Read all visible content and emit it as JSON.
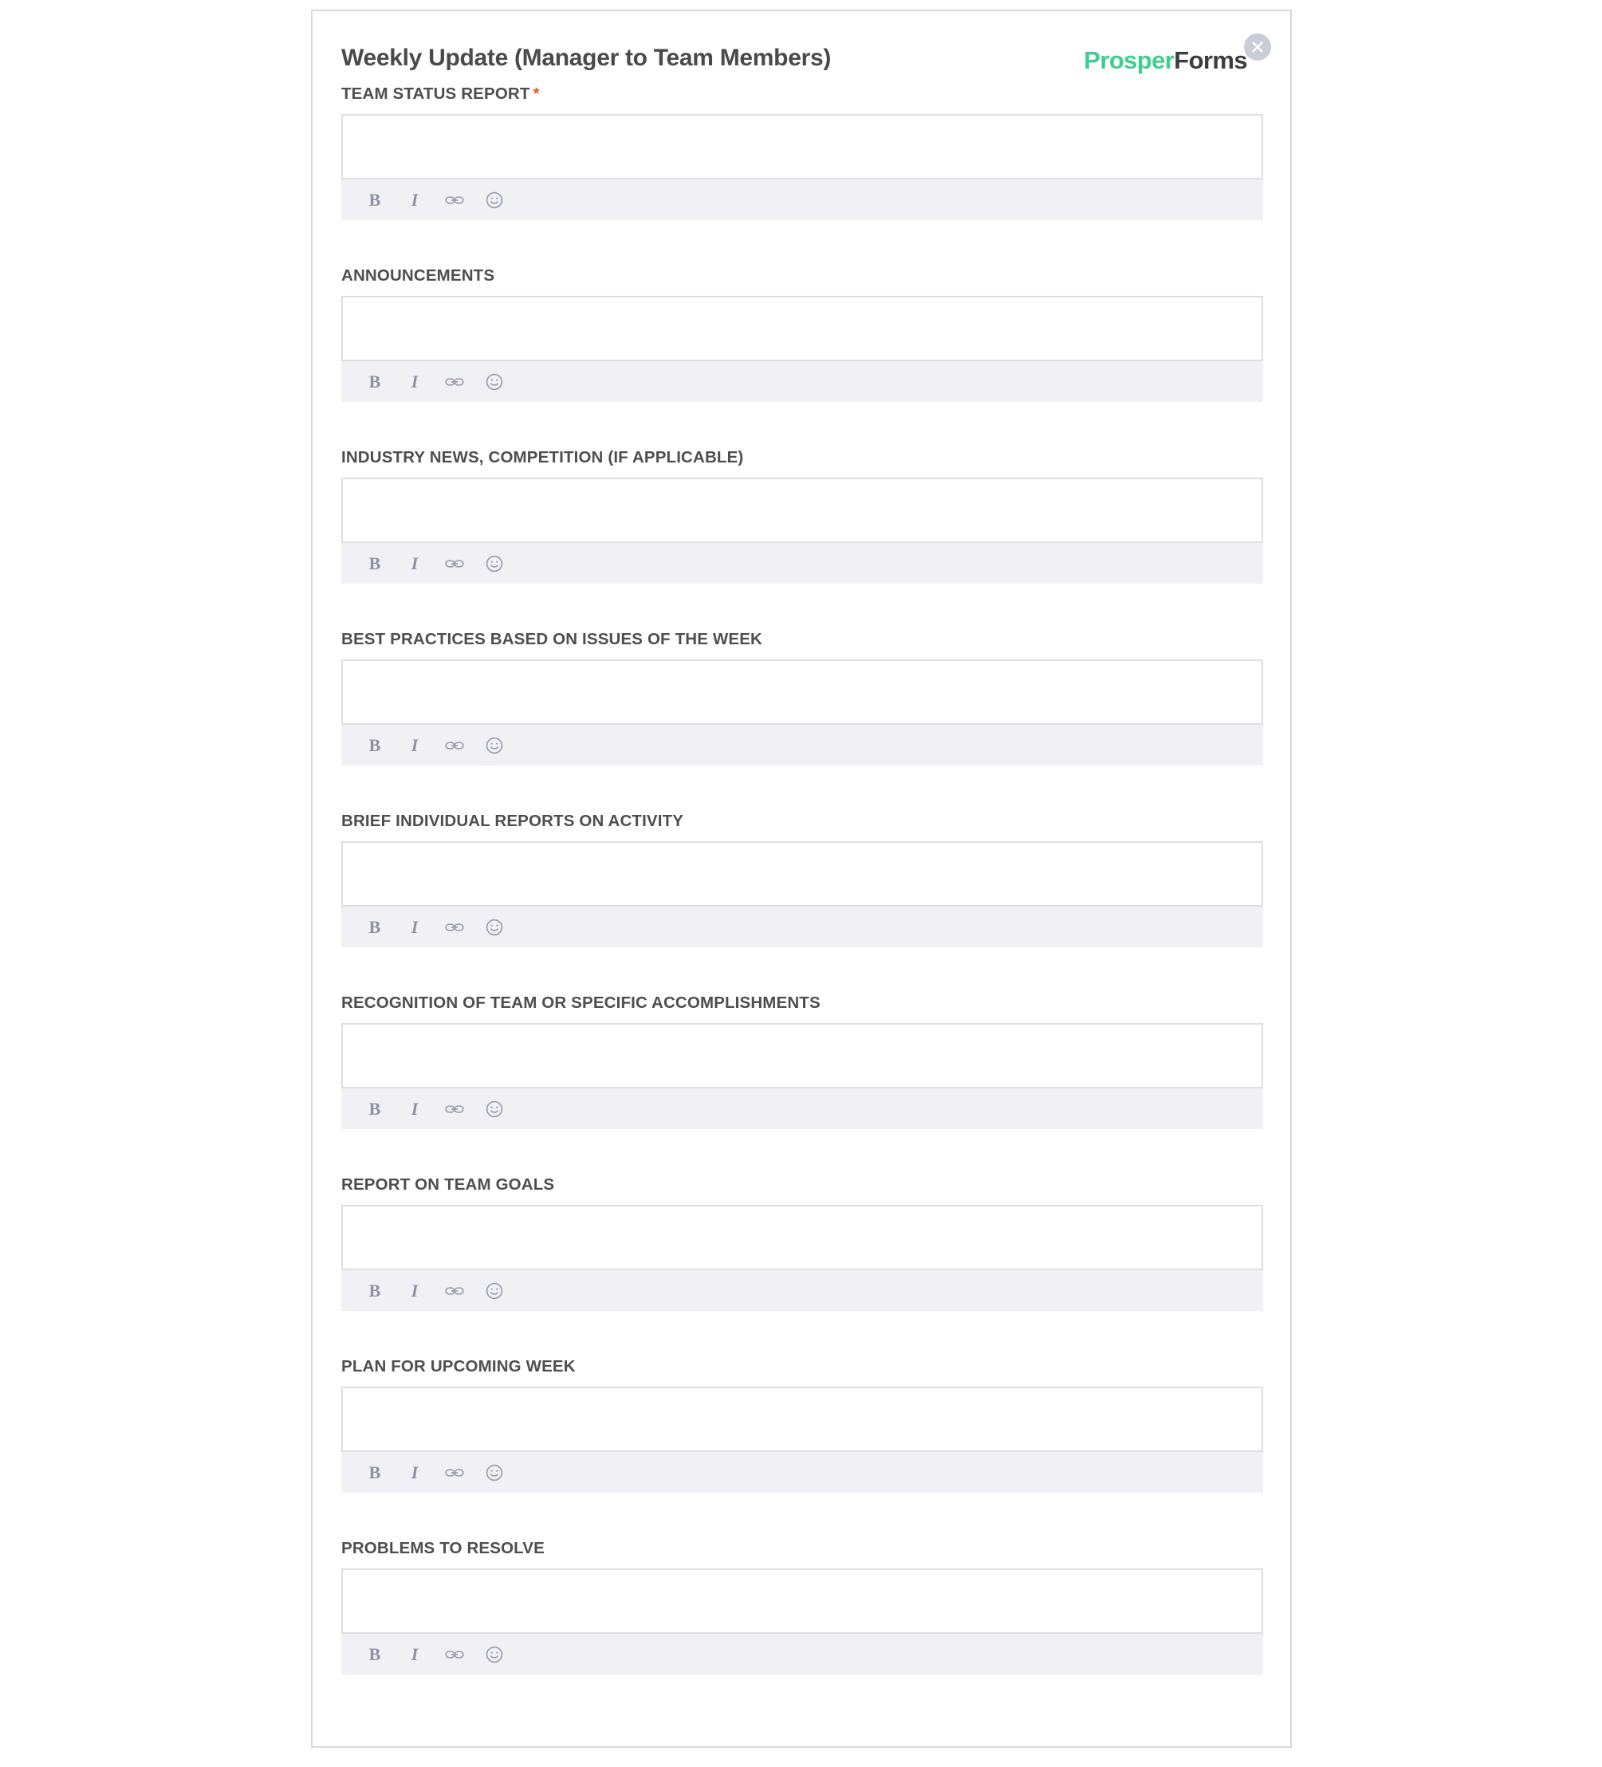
{
  "header": {
    "title": "Weekly Update (Manager to Team Members)",
    "brand_primary": "Prosper",
    "brand_secondary": "Forms",
    "brand_primary_color": "#3fce8f",
    "brand_secondary_color": "#3d3d3d",
    "close_icon": "close-icon"
  },
  "required_marker": "*",
  "toolbar": {
    "bold_label": "B",
    "italic_label": "I",
    "bold_icon": "bold-icon",
    "italic_icon": "italic-icon",
    "link_icon": "link-icon",
    "emoji_icon": "emoji-smiley-icon"
  },
  "fields": [
    {
      "label": "TEAM STATUS REPORT",
      "required": true,
      "value": ""
    },
    {
      "label": "ANNOUNCEMENTS",
      "required": false,
      "value": ""
    },
    {
      "label": "INDUSTRY NEWS, COMPETITION (IF APPLICABLE)",
      "required": false,
      "value": ""
    },
    {
      "label": "BEST PRACTICES BASED ON ISSUES OF THE WEEK",
      "required": false,
      "value": ""
    },
    {
      "label": "BRIEF INDIVIDUAL REPORTS ON ACTIVITY",
      "required": false,
      "value": ""
    },
    {
      "label": "RECOGNITION OF TEAM OR SPECIFIC ACCOMPLISHMENTS",
      "required": false,
      "value": ""
    },
    {
      "label": "REPORT ON TEAM GOALS",
      "required": false,
      "value": ""
    },
    {
      "label": "PLAN FOR UPCOMING WEEK",
      "required": false,
      "value": ""
    },
    {
      "label": "PROBLEMS TO RESOLVE",
      "required": false,
      "value": ""
    }
  ]
}
